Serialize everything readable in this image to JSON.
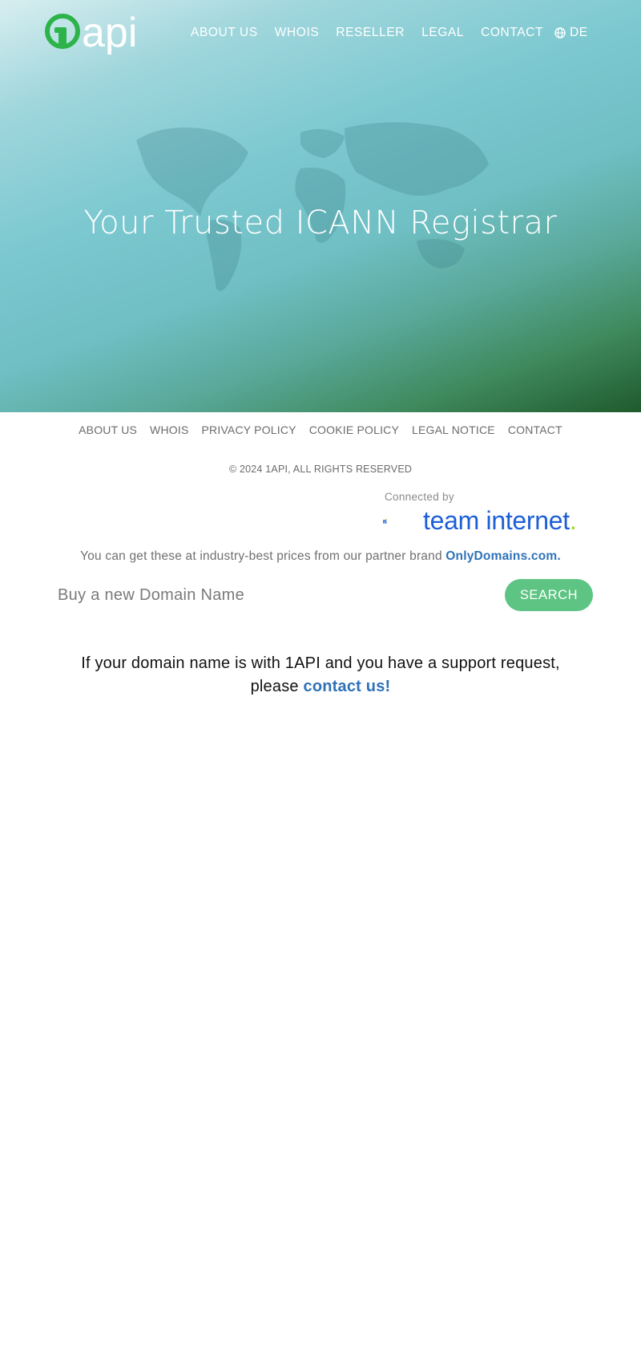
{
  "brand": {
    "logo_text": "api"
  },
  "topnav": {
    "items": [
      "ABOUT US",
      "WHOIS",
      "RESELLER",
      "LEGAL",
      "CONTACT"
    ],
    "language": "DE"
  },
  "hero": {
    "title": "Your Trusted ICANN Registrar"
  },
  "footer": {
    "links": [
      "ABOUT US",
      "WHOIS",
      "PRIVACY POLICY",
      "COOKIE POLICY",
      "LEGAL NOTICE",
      "CONTACT"
    ],
    "copyright": "© 2024 1API, ALL RIGHTS RESERVED",
    "connected_by": "Connected by",
    "partner_logo_text": "team internet",
    "partner_logo_dot": "."
  },
  "partner": {
    "text": "You can get these at industry-best prices from our partner brand ",
    "link": "OnlyDomains.com."
  },
  "search": {
    "placeholder": "Buy a new Domain Name",
    "button": "SEARCH"
  },
  "support": {
    "line1": "If your domain name is with 1API and you have a support request,",
    "line2_prefix": "please ",
    "link": "contact us!"
  },
  "colors": {
    "brand_green": "#2db34a",
    "button_green": "#5ec483",
    "link_blue": "#2f72b8",
    "team_internet_blue": "#1d5fd6",
    "team_internet_accent": "#a6d41e"
  }
}
